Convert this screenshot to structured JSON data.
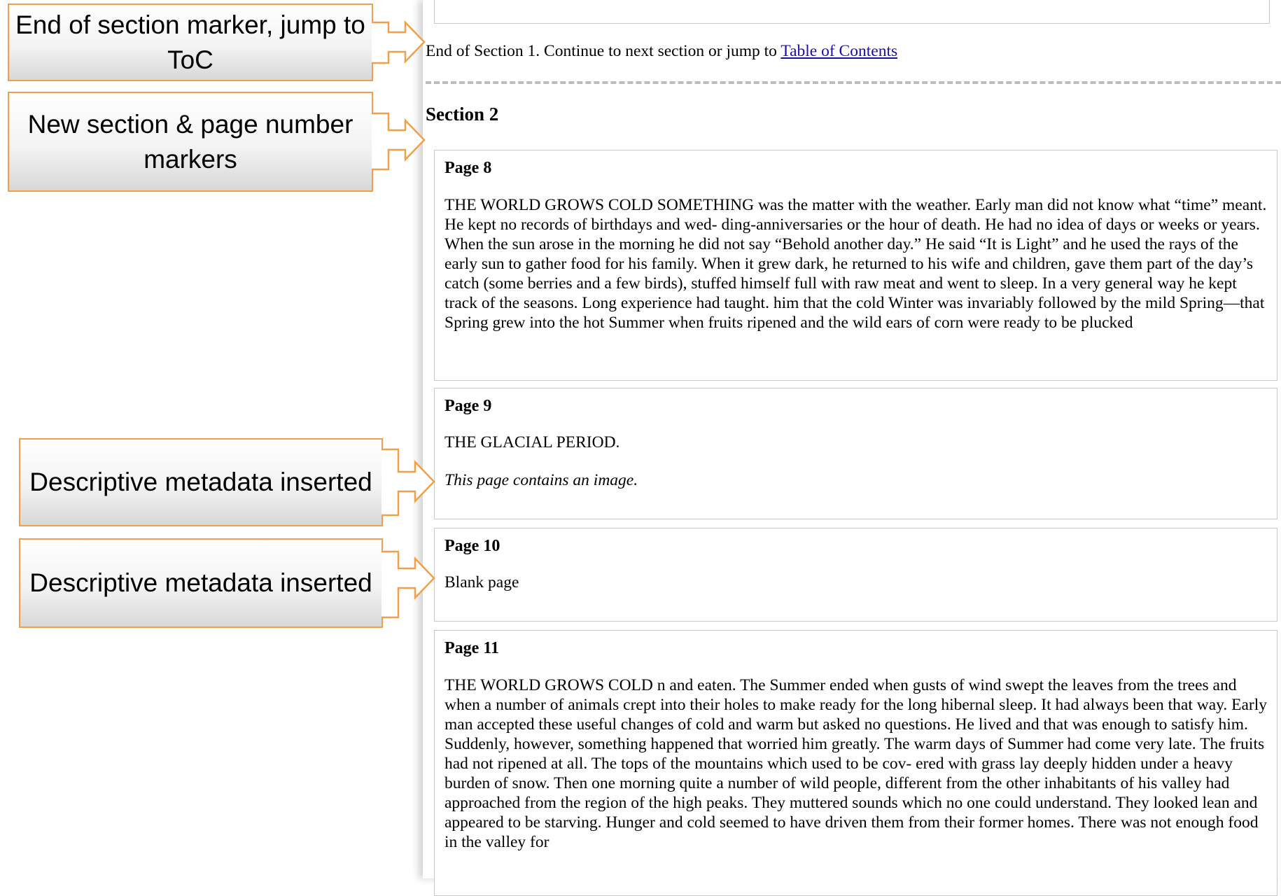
{
  "callouts": {
    "end_marker": "End of section marker, jump to ToC",
    "section_markers": "New section & page number markers",
    "metadata_1": "Descriptive metadata inserted",
    "metadata_2": "Descriptive metadata inserted"
  },
  "end_of_section": {
    "text": "End of Section 1. Continue to next section or jump to ",
    "link": "Table of Contents"
  },
  "section": {
    "title": "Section 2"
  },
  "pages": [
    {
      "label": "Page 8",
      "text": "THE WORLD GROWS COLD SOMETHING was the matter with the weather. Early man did not know what “time” meant. He kept no records of birthdays and wed- ding-anniversaries or the hour of death. He had no idea of days or weeks or years. When the sun arose in the morning he did not say “Behold another day.” He said “It is Light” and he used the rays of the early sun to gather food for his family. When it grew dark, he returned to his wife and children, gave them part of the day’s catch (some berries and a few birds), stuffed himself full with raw meat and went to sleep. In a very general way he kept track of the seasons. Long experience had taught. him that the cold Winter was invariably followed by the mild Spring—that Spring grew into the hot Summer when fruits ripened and the wild ears of corn were ready to be plucked"
    },
    {
      "label": "Page 9",
      "text": "THE GLACIAL PERIOD.",
      "note": "This page contains an image."
    },
    {
      "label": "Page 10",
      "text": "Blank page"
    },
    {
      "label": "Page 11",
      "text": "THE WORLD GROWS COLD n and eaten. The Summer ended when gusts of wind swept the leaves from the trees and when a number of animals crept into their holes to make ready for the long hibernal sleep. It had always been that way. Early man accepted these useful changes of cold and warm but asked no questions. He lived and that was enough to satisfy him. Suddenly, however, something happened that worried him greatly. The warm days of Summer had come very late. The fruits had not ripened at all. The tops of the mountains which used to be cov- ered with grass lay deeply hidden under a heavy burden of snow. Then one morning quite a number of wild people, different from the other inhabitants of his valley had approached from the region of the high peaks. They muttered sounds which no one could understand. They looked lean and appeared to be starving. Hunger and cold seemed to have driven them from their former homes. There was not enough food in the valley for"
    }
  ]
}
